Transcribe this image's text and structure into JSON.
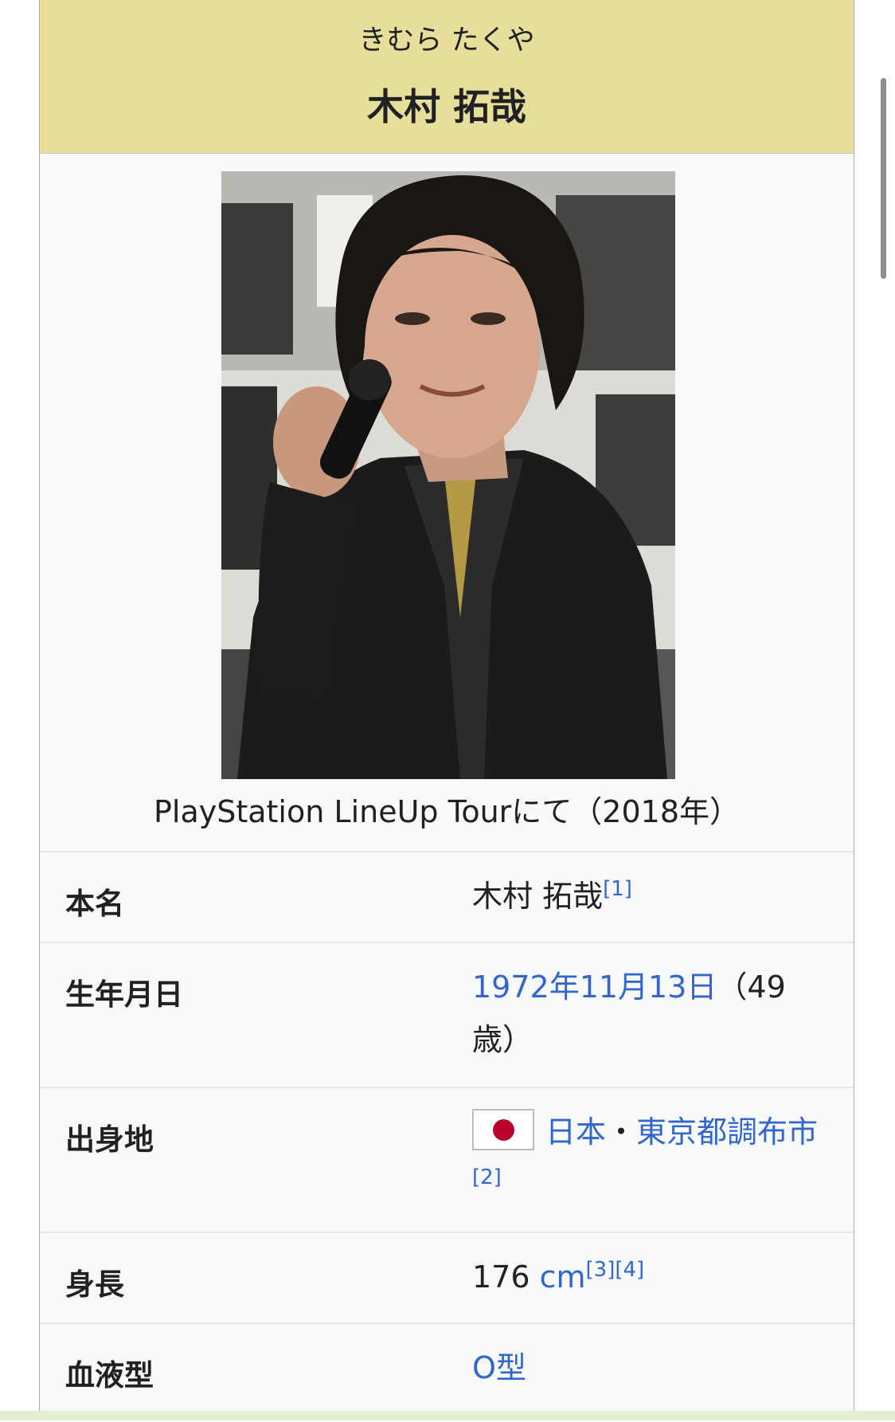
{
  "infobox": {
    "reading": "きむら たくや",
    "name": "木村 拓哉",
    "caption": "PlayStation LineUp Tourにて（2018年）",
    "rows": [
      {
        "label": "本名",
        "value_text": "木村 拓哉",
        "refs": "[1]"
      },
      {
        "label": "生年月日",
        "date_link": "1972年11月13日",
        "age_text": "（49歳）"
      },
      {
        "label": "出身地",
        "country_link": "日本",
        "separator": "・",
        "city_link": "東京都調布市",
        "refs": "[2]"
      },
      {
        "label": "身長",
        "value_text": "176 ",
        "unit_link": "cm",
        "refs": "[3][4]"
      },
      {
        "label": "血液型",
        "value_link": "O型"
      }
    ]
  },
  "colors": {
    "header_bg": "#e8de9b",
    "link": "#3366cc",
    "infobox_bg": "#f8f9fa",
    "flag_red": "#bc002d"
  },
  "icons": {
    "flag": "japan-flag-icon"
  }
}
